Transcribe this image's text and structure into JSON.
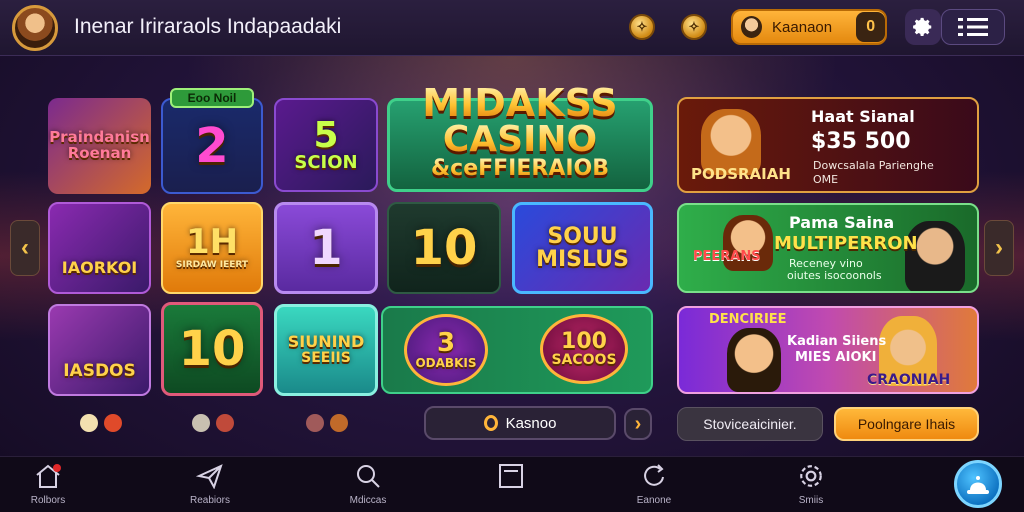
{
  "header": {
    "title": "Inenar Iriraraols Indapaadaki",
    "coin_1": "✧",
    "coin_2": "✧",
    "account_label": "Kaanaon",
    "account_badge": "0",
    "settings_icon": "gear-icon",
    "menu_icon": "list-menu-icon"
  },
  "tiles": {
    "t1": "Praindanisn Roenan",
    "badge": "Eoo Noil",
    "t2": "2",
    "t3_num": "5",
    "t3": "SCION",
    "hero_line1": "MIDAKSS",
    "hero_line2": "CASINO",
    "hero_line3": "&ceFFIERAIOB",
    "t5": "IAORKOI",
    "t6_num": "1H",
    "t6_sub": "SIRDAW IEERT",
    "t7": "1",
    "t8": "10",
    "t9_line1": "SOUU",
    "t9_line2": "MISLUS",
    "t10": "IASDOS",
    "t11": "10",
    "t12_line1": "SIUNIND",
    "t12_line2": "SEEIIS",
    "t13_num": "3",
    "t13": "ODABKIS",
    "t14_num": "100",
    "t14": "SACOOS"
  },
  "banners": {
    "b1_title": "Haat Sianal",
    "b1_amount": "$35 500",
    "b1_name": "PODSRAIAH",
    "b1_desc1": "Dowcsalala Parienghe",
    "b1_desc2": "OME",
    "b2_title": "Pama Saina",
    "b2_headline": "MULTIPERRON",
    "b2_desc1": "Receney vino",
    "b2_desc2": "oiutes isocoonols",
    "b2_tag": "PEERANS",
    "b3_line1": "Kadian Siiens",
    "b3_line2": "MIES AIOKI",
    "b3_tag": "CRAONIAH",
    "b3_arc": "DENCIRIEE"
  },
  "actions": {
    "kasnoo_label": "Kasnoo",
    "next_label": "›",
    "secondary_label": "Stoviceaicinier.",
    "primary_label": "Poolngare Ihais"
  },
  "nav": {
    "items": [
      {
        "label": "Rolbors",
        "icon": "home-icon"
      },
      {
        "label": "Reabiors",
        "icon": "send-icon"
      },
      {
        "label": "Mdiccas",
        "icon": "search-icon"
      },
      {
        "label": "",
        "icon": "image-icon"
      },
      {
        "label": "Eanone",
        "icon": "refresh-icon"
      },
      {
        "label": "Smiis",
        "icon": "gear-icon"
      }
    ]
  },
  "colors": {
    "accent_orange": "#f5a623",
    "hero_green": "#1f8a5a",
    "banner_green": "#1d7a3a"
  }
}
